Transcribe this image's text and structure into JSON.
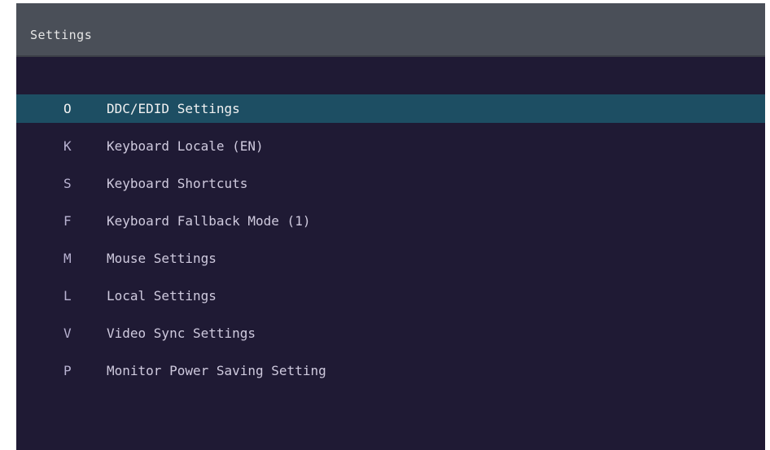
{
  "window": {
    "title": "Settings"
  },
  "colors": {
    "title_bar": "#4a4f58",
    "background": "#1f1a34",
    "selected_row": "#1d4e63",
    "text": "#cfcade"
  },
  "menu": {
    "selected_index": 0,
    "items": [
      {
        "key": "O",
        "label": "DDC/EDID Settings"
      },
      {
        "key": "K",
        "label": "Keyboard Locale (EN)"
      },
      {
        "key": "S",
        "label": "Keyboard Shortcuts"
      },
      {
        "key": "F",
        "label": "Keyboard Fallback Mode (1)"
      },
      {
        "key": "M",
        "label": "Mouse Settings"
      },
      {
        "key": "L",
        "label": "Local Settings"
      },
      {
        "key": "V",
        "label": "Video Sync Settings"
      },
      {
        "key": "P",
        "label": "Monitor Power Saving Setting"
      }
    ]
  }
}
